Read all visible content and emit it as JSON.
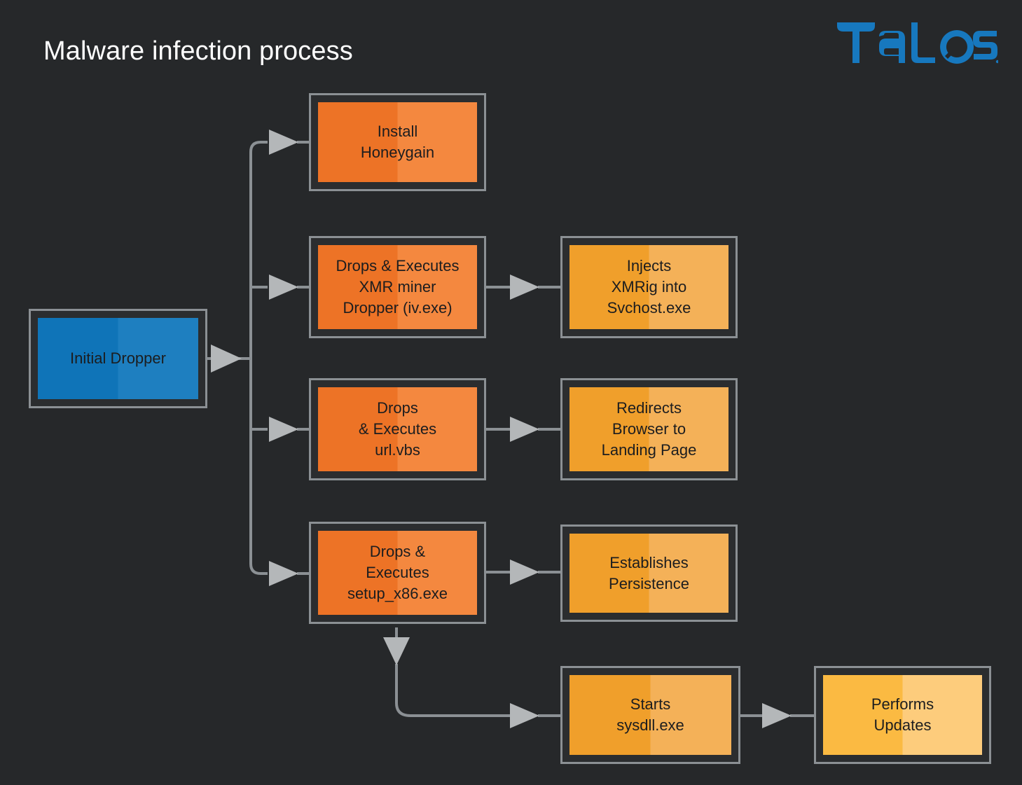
{
  "page": {
    "title": "Malware infection process",
    "background_color": "#26282a",
    "title_color": "#ffffff"
  },
  "brand": {
    "name": "TALOS",
    "logo_color": "#1778be",
    "trademark": "®"
  },
  "palette": {
    "connector": "#8b9094",
    "box_border": "#8b9094",
    "box_gap": "#2b2d2f",
    "blue_dark": "#0f74b8",
    "blue_light": "#1e7fc0",
    "orange_dark": "#ed7326",
    "orange_light": "#f4883f",
    "amber_dark": "#f09f2b",
    "amber_light": "#f4b158",
    "gold_dark": "#fbba42",
    "gold_light": "#fdcc7c",
    "text_dark": "#1c1d1f"
  },
  "nodes": {
    "initial_dropper": {
      "label": "Initial Dropper",
      "color": "blue"
    },
    "install_honeygain": {
      "label": "Install\nHoneygain",
      "color": "orange"
    },
    "xmr_dropper": {
      "label": "Drops & Executes\nXMR miner\nDropper (iv.exe)",
      "color": "orange"
    },
    "injects_xmrig": {
      "label": "Injects\nXMRig into\nSvchost.exe",
      "color": "amber"
    },
    "url_vbs": {
      "label": "Drops\n& Executes\nurl.vbs",
      "color": "orange"
    },
    "redirects_browser": {
      "label": "Redirects\nBrowser to\nLanding Page",
      "color": "amber"
    },
    "setup_x86": {
      "label": "Drops &\nExecutes\nsetup_x86.exe",
      "color": "orange"
    },
    "establishes_persistence": {
      "label": "Establishes\nPersistence",
      "color": "amber"
    },
    "starts_sysdll": {
      "label": "Starts\nsysdll.exe",
      "color": "amber"
    },
    "performs_updates": {
      "label": "Performs\nUpdates",
      "color": "gold"
    }
  },
  "edges": [
    {
      "from": "initial_dropper",
      "to": "install_honeygain"
    },
    {
      "from": "initial_dropper",
      "to": "xmr_dropper"
    },
    {
      "from": "initial_dropper",
      "to": "url_vbs"
    },
    {
      "from": "initial_dropper",
      "to": "setup_x86"
    },
    {
      "from": "xmr_dropper",
      "to": "injects_xmrig"
    },
    {
      "from": "url_vbs",
      "to": "redirects_browser"
    },
    {
      "from": "setup_x86",
      "to": "establishes_persistence"
    },
    {
      "from": "setup_x86",
      "to": "starts_sysdll"
    },
    {
      "from": "starts_sysdll",
      "to": "performs_updates"
    }
  ]
}
